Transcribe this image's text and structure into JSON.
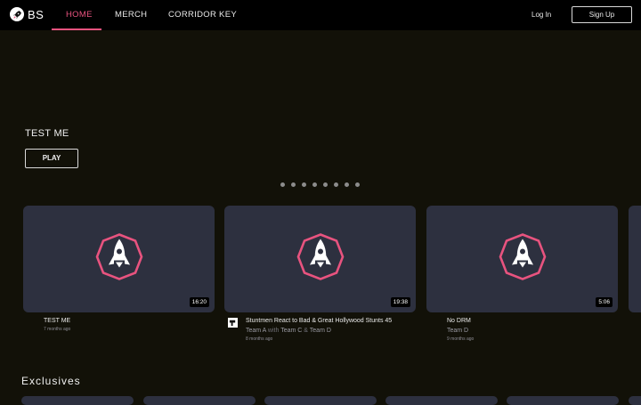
{
  "nav": {
    "brand": "BS",
    "links": [
      {
        "label": "HOME"
      },
      {
        "label": "MERCH"
      },
      {
        "label": "CORRIDOR KEY"
      }
    ],
    "login": "Log In",
    "signup": "Sign Up",
    "accent": "#e8537f"
  },
  "hero": {
    "title": "TEST ME",
    "play": "PLAY",
    "slide_count": 8
  },
  "cards": [
    {
      "title": "TEST ME",
      "time": "7 months ago",
      "duration": "16:20"
    },
    {
      "title": "Stuntmen React to Bad & Great Hollywood Stunts 45",
      "team_a": "Team A",
      "with": "with",
      "team_c": "Team C",
      "amp": "&",
      "team_d": "Team D",
      "time": "8 months ago",
      "duration": "19:38"
    },
    {
      "title": "No DRM",
      "team": "Team D",
      "time": "9 months ago",
      "duration": "5:06"
    }
  ],
  "exclusives": {
    "title": "Exclusives"
  }
}
